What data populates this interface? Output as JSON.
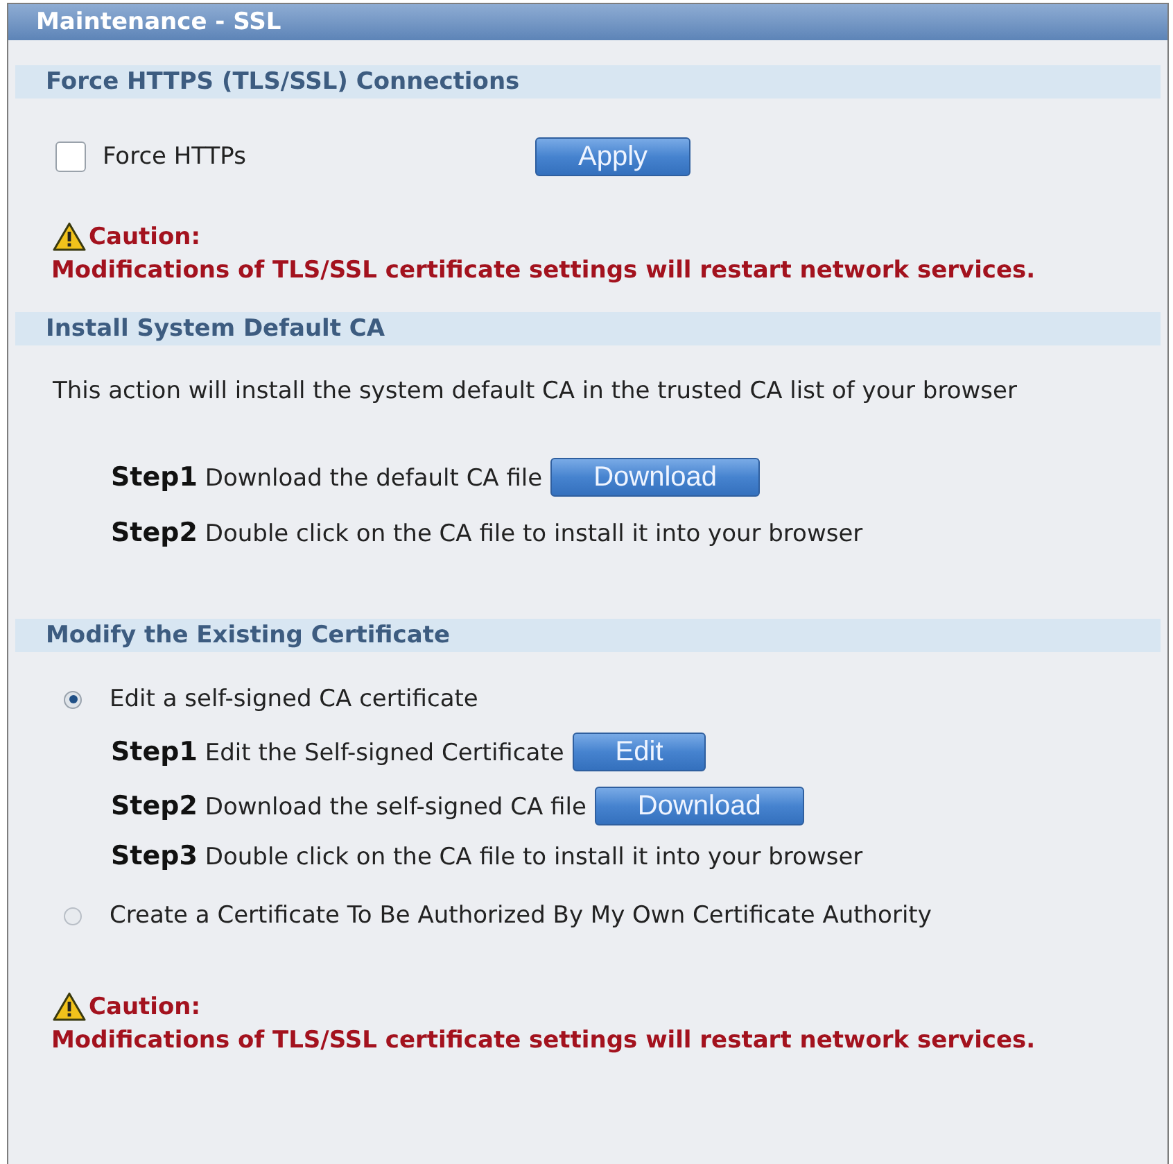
{
  "window": {
    "title": "Maintenance - SSL"
  },
  "force_https": {
    "heading": "Force HTTPS (TLS/SSL) Connections",
    "checkbox": {
      "label": "Force HTTPs",
      "checked": false
    },
    "button": "Apply",
    "caution": {
      "title": "Caution:",
      "message": "Modifications of TLS/SSL certificate settings will restart network services."
    }
  },
  "install_ca": {
    "heading": "Install System Default CA",
    "description": "This action will install the system default CA in the trusted CA list of your browser",
    "steps": [
      {
        "text": "**Step1** Download the default CA file",
        "button": "Download"
      },
      {
        "text": "**Step2** Double click on the CA file to install it into your browser"
      }
    ]
  },
  "modify_certificate": {
    "heading": "Modify the Existing Certificate",
    "options": [
      {
        "label": "Edit a self-signed CA certificate",
        "selected": true,
        "steps": [
          {
            "text": "**Step1** Edit the Self-signed Certificate",
            "button": "Edit"
          },
          {
            "text": "**Step2** Download the self-signed CA file",
            "button": "Download"
          },
          {
            "text": "**Step3** Double click on the CA file to install it into your browser"
          }
        ]
      },
      {
        "label": "Create a Certificate To Be Authorized By My Own Certificate Authority",
        "selected": false
      }
    ],
    "caution": {
      "title": "Caution:",
      "message": "Modifications of TLS/SSL certificate settings will restart network services."
    }
  }
}
